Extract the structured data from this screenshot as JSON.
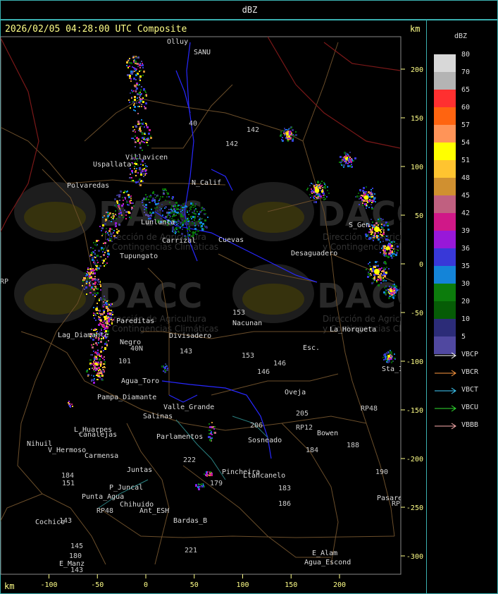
{
  "header": {
    "product_label": "dBZ",
    "timestamp": "2026/02/05 04:28:00 UTC Composite",
    "unit_top": "km",
    "unit_bottom": "km"
  },
  "axes": {
    "x_ticks": [
      "-100",
      "-50",
      "0",
      "50",
      "100",
      "150",
      "200"
    ],
    "y_ticks": [
      "200",
      "150",
      "100",
      "50",
      "0",
      "-50",
      "-100",
      "-150",
      "-200",
      "-250",
      "-300"
    ]
  },
  "legend": {
    "title": "dBZ",
    "levels": [
      {
        "label": "80",
        "color": "#d8d8d8"
      },
      {
        "label": "70",
        "color": "#b4b4b4"
      },
      {
        "label": "65",
        "color": "#ff3030"
      },
      {
        "label": "60",
        "color": "#ff6410"
      },
      {
        "label": "57",
        "color": "#ff9458"
      },
      {
        "label": "54",
        "color": "#ffff00"
      },
      {
        "label": "51",
        "color": "#ffc430"
      },
      {
        "label": "48",
        "color": "#d09030"
      },
      {
        "label": "45",
        "color": "#c06080"
      },
      {
        "label": "42",
        "color": "#d01888"
      },
      {
        "label": "39",
        "color": "#9818d8"
      },
      {
        "label": "36",
        "color": "#3838d8"
      },
      {
        "label": "35",
        "color": "#1484d8"
      },
      {
        "label": "30",
        "color": "#0c7c0c"
      },
      {
        "label": "20",
        "color": "#065c06"
      },
      {
        "label": "10",
        "color": "#2c2c78"
      },
      {
        "label": "5",
        "color": "#5048a0"
      }
    ]
  },
  "stations": [
    {
      "label": "VBCP",
      "color": "#ffffff"
    },
    {
      "label": "VBCR",
      "color": "#ff9a40"
    },
    {
      "label": "VBCT",
      "color": "#40d0ff"
    },
    {
      "label": "VBCU",
      "color": "#30e030"
    },
    {
      "label": "VBBB",
      "color": "#ffb0b0"
    }
  ],
  "watermark": {
    "brand": "DACC",
    "subtitle_1": "Dirección de Agricultura",
    "subtitle_2": "y Contingencias Climáticas"
  },
  "places": [
    {
      "text": "Olluy",
      "color": "#dddddd"
    },
    {
      "text": "SANU",
      "color": "#dddddd"
    },
    {
      "text": "142",
      "color": "#cccccc"
    },
    {
      "text": "142",
      "color": "#cccccc"
    },
    {
      "text": "40",
      "color": "#cccccc"
    },
    {
      "text": "Uspallata",
      "color": "#dddddd"
    },
    {
      "text": "Polvaredas",
      "color": "#dddddd"
    },
    {
      "text": "Villavicen",
      "color": "#dddddd"
    },
    {
      "text": "N_Calif",
      "color": "#dddddd"
    },
    {
      "text": "Lunlunta",
      "color": "#dddddd"
    },
    {
      "text": "Carrizal",
      "color": "#dddddd"
    },
    {
      "text": "Cuevas",
      "color": "#dddddd"
    },
    {
      "text": "Desaguadero",
      "color": "#dddddd"
    },
    {
      "text": "S_Gen",
      "color": "#dddddd"
    },
    {
      "text": "Tupungato",
      "color": "#dddddd"
    },
    {
      "text": "Pareditas",
      "color": "#dddddd"
    },
    {
      "text": "153",
      "color": "#cccccc"
    },
    {
      "text": "Nacunan",
      "color": "#dddddd"
    },
    {
      "text": "La_Horqueta",
      "color": "#dddddd"
    },
    {
      "text": "Lag_Diamante",
      "color": "#dddddd"
    },
    {
      "text": "Negro",
      "color": "#dddddd"
    },
    {
      "text": "Divisadero",
      "color": "#dddddd"
    },
    {
      "text": "143",
      "color": "#cccccc"
    },
    {
      "text": "Esc.",
      "color": "#dddddd"
    },
    {
      "text": "153",
      "color": "#cccccc"
    },
    {
      "text": "146",
      "color": "#cccccc"
    },
    {
      "text": "146",
      "color": "#cccccc"
    },
    {
      "text": "40N",
      "color": "#cccccc"
    },
    {
      "text": "101",
      "color": "#cccccc"
    },
    {
      "text": "Agua_Toro",
      "color": "#dddddd"
    },
    {
      "text": "Pampa_Diamante",
      "color": "#dddddd"
    },
    {
      "text": "Valle_Grande",
      "color": "#dddddd"
    },
    {
      "text": "Salinas",
      "color": "#dddddd"
    },
    {
      "text": "Oveja",
      "color": "#dddddd"
    },
    {
      "text": "205",
      "color": "#cccccc"
    },
    {
      "text": "206",
      "color": "#cccccc"
    },
    {
      "text": "RP12",
      "color": "#cccccc"
    },
    {
      "text": "Bowen",
      "color": "#dddddd"
    },
    {
      "text": "188",
      "color": "#cccccc"
    },
    {
      "text": "L_Huarpes",
      "color": "#dddddd"
    },
    {
      "text": "Canalejas",
      "color": "#dddddd"
    },
    {
      "text": "Parlamentos",
      "color": "#dddddd"
    },
    {
      "text": "Sosneado",
      "color": "#dddddd"
    },
    {
      "text": "Nihuil",
      "color": "#dddddd"
    },
    {
      "text": "Carmensa",
      "color": "#dddddd"
    },
    {
      "text": "V_Hermoso",
      "color": "#dddddd"
    },
    {
      "text": "Juntas",
      "color": "#dddddd"
    },
    {
      "text": "222",
      "color": "#cccccc"
    },
    {
      "text": "184",
      "color": "#cccccc"
    },
    {
      "text": "184",
      "color": "#cccccc"
    },
    {
      "text": "151",
      "color": "#cccccc"
    },
    {
      "text": "P_Juncal",
      "color": "#dddddd"
    },
    {
      "text": "Pincheira",
      "color": "#dddddd"
    },
    {
      "text": "Llancanelo",
      "color": "#dddddd"
    },
    {
      "text": "179",
      "color": "#cccccc"
    },
    {
      "text": "190",
      "color": "#cccccc"
    },
    {
      "text": "Punta_Agua",
      "color": "#dddddd"
    },
    {
      "text": "RP48",
      "color": "#cccccc"
    },
    {
      "text": "Chihuido",
      "color": "#dddddd"
    },
    {
      "text": "Ant_ESH",
      "color": "#dddddd"
    },
    {
      "text": "186",
      "color": "#cccccc"
    },
    {
      "text": "183",
      "color": "#cccccc"
    },
    {
      "text": "143",
      "color": "#cccccc"
    },
    {
      "text": "Cochico",
      "color": "#dddddd"
    },
    {
      "text": "Bardas_B",
      "color": "#dddddd"
    },
    {
      "text": "145",
      "color": "#cccccc"
    },
    {
      "text": "180",
      "color": "#cccccc"
    },
    {
      "text": "E_Manz",
      "color": "#dddddd"
    },
    {
      "text": "221",
      "color": "#cccccc"
    },
    {
      "text": "E_Alam",
      "color": "#dddddd"
    },
    {
      "text": "Agua_Escond",
      "color": "#dddddd"
    },
    {
      "text": "143",
      "color": "#cccccc"
    },
    {
      "text": "Sta_Isabel",
      "color": "#dddddd"
    },
    {
      "text": "Pasarela",
      "color": "#dddddd"
    },
    {
      "text": "RP3",
      "color": "#cccccc"
    },
    {
      "text": "RP48",
      "color": "#cccccc"
    },
    {
      "text": "RP",
      "color": "#cccccc"
    },
    {
      "text": "RP3",
      "color": "#cccccc"
    },
    {
      "text": "ago",
      "color": "#dddddd"
    }
  ]
}
